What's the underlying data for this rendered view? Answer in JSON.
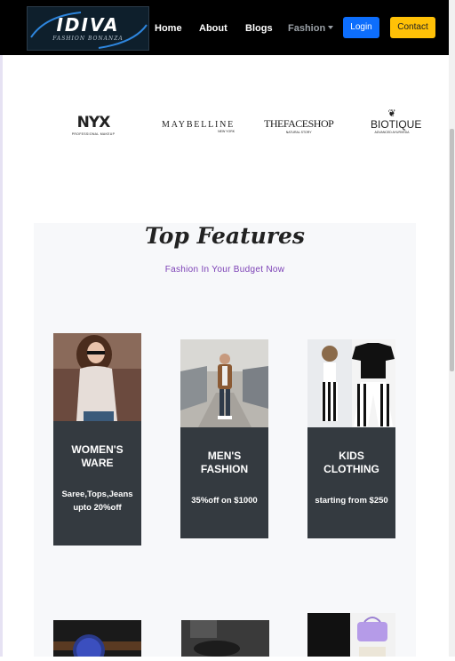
{
  "nav": {
    "logo_title": "IDIVA",
    "logo_subtitle": "FASHION BONANZA",
    "links": [
      "Home",
      "About",
      "Blogs",
      "Fashion"
    ],
    "login_label": "Login",
    "contact_label": "Contact"
  },
  "brands": [
    {
      "name": "NYX",
      "tagline": "PROFESSIONAL MAKEUP"
    },
    {
      "name": "MAYBELLINE",
      "tagline": "NEW YORK"
    },
    {
      "name": "THEFACESHOP",
      "tagline": "NATURAL STORY"
    },
    {
      "name": "BIOTIQUE",
      "tagline": "ADVANCED AYURVEDA"
    }
  ],
  "features": {
    "title": "Top Features",
    "subtitle": "Fashion In Your Budget Now",
    "cards": [
      {
        "title": "WOMEN'S WARE",
        "desc": "Saree,Tops,Jeans upto 20%off"
      },
      {
        "title": "MEN'S FASHION",
        "desc": "35%off on $1000"
      },
      {
        "title": "KIDS CLOTHING",
        "desc": "starting from $250"
      }
    ]
  },
  "colors": {
    "navbar_bg": "#000000",
    "login_bg": "#0d6efd",
    "contact_bg": "#ffc107",
    "card_body_bg": "#343a40",
    "subtitle_color": "#7b3fb5",
    "section_bg": "#f7f8fa"
  }
}
